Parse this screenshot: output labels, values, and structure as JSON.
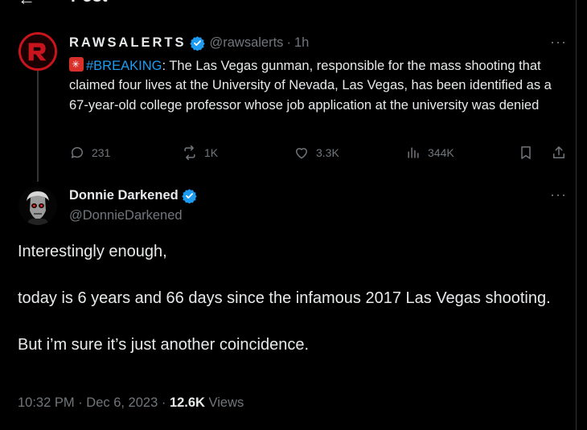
{
  "header": {
    "title": "Post"
  },
  "tweet1": {
    "display_name": "RAWSALERTS",
    "handle": "@rawsalerts",
    "separator": "·",
    "time": "1h",
    "hashtag": "#BREAKING",
    "text": ": The Las Vegas gunman, responsible for the mass shooting that claimed four lives at the University of Nevada, Las Vegas, has been identified as a 67-year-old college professor whose job application at the university was denied",
    "replies": "231",
    "reposts": "1K",
    "likes": "3.3K",
    "views": "344K"
  },
  "tweet2": {
    "display_name": "Donnie Darkened",
    "handle": "@DonnieDarkened",
    "paragraphs": [
      "Interestingly enough,",
      "today is 6 years and 66 days since the infamous 2017 Las Vegas shooting.",
      "But i’m sure it’s just another coincidence."
    ],
    "timestamp": "10:32 PM · Dec 6, 2023 · ",
    "views_count": "12.6K",
    "views_label": " Views"
  },
  "colors": {
    "accent": "#1d9bf0",
    "muted": "#71767b",
    "text": "#e7e9ea",
    "background": "#000000"
  }
}
